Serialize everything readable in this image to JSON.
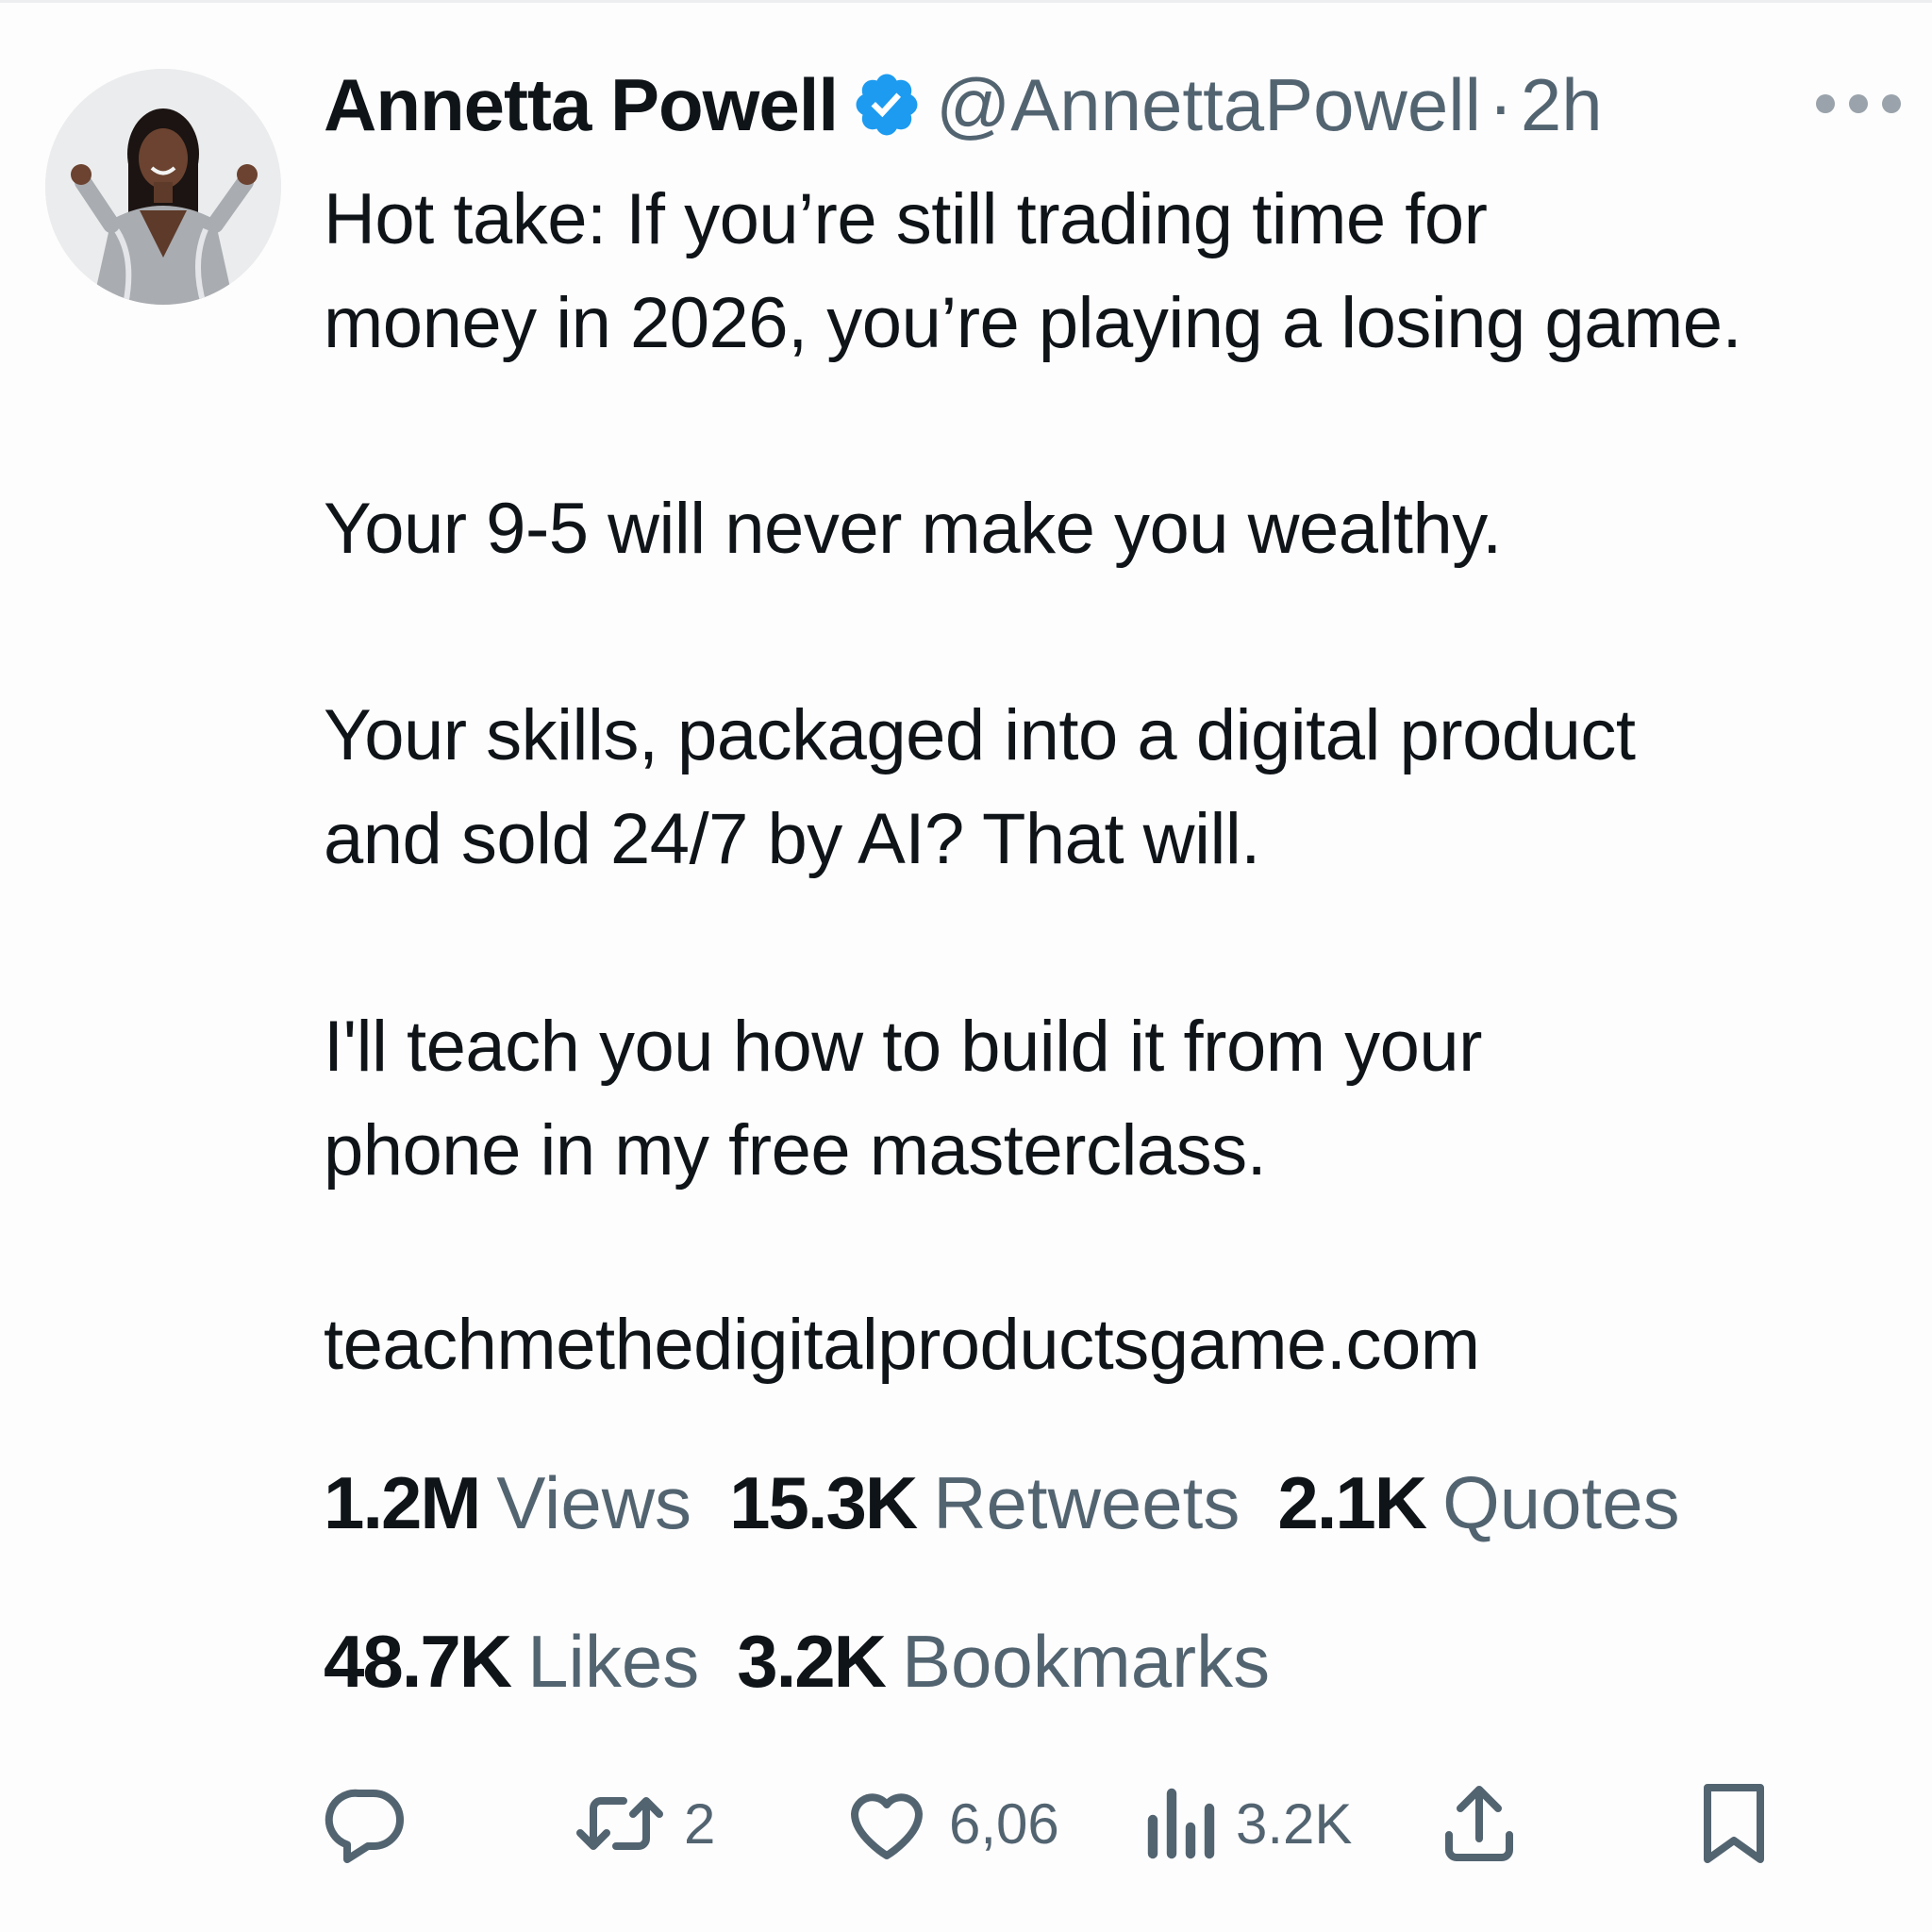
{
  "author": {
    "display_name": "Annetta Powell",
    "handle": "@AnnettaPowell",
    "separator": "·",
    "time": "2h",
    "verified": true,
    "verified_color": "#1d9bf0"
  },
  "tweet": {
    "lines": [
      "Hot take: If you’re still trading time for",
      "money in 2026, you’re playing a losing game.",
      "Your 9-5 will never make you wealthy.",
      "Your skills, packaged into a digital product",
      "and sold 24/7 by AI? That will.",
      "I'll teach you how to build it from your",
      "phone in my free masterclass.",
      "teachmethedigitalproductsgame.com"
    ]
  },
  "stats": [
    {
      "value": "1.2M",
      "label": "Views"
    },
    {
      "value": "15.3K",
      "label": "Retweets"
    },
    {
      "value": "2.1K",
      "label": "Quotes"
    },
    {
      "value": "48.7K",
      "label": "Likes"
    },
    {
      "value": "3.2K",
      "label": "Bookmarks"
    }
  ],
  "actions": {
    "reply_icon": "reply-icon",
    "retweet_icon": "retweet-icon",
    "retweet_count": "2",
    "like_icon": "heart-icon",
    "like_count": "6,06",
    "views_icon": "bar-chart-icon",
    "views_count": "3.2K",
    "share_icon": "share-icon",
    "bookmark_icon": "bookmark-icon"
  },
  "colors": {
    "text_primary": "#0f1419",
    "text_secondary": "#536471",
    "icon": "#536471",
    "accent": "#1d9bf0"
  }
}
